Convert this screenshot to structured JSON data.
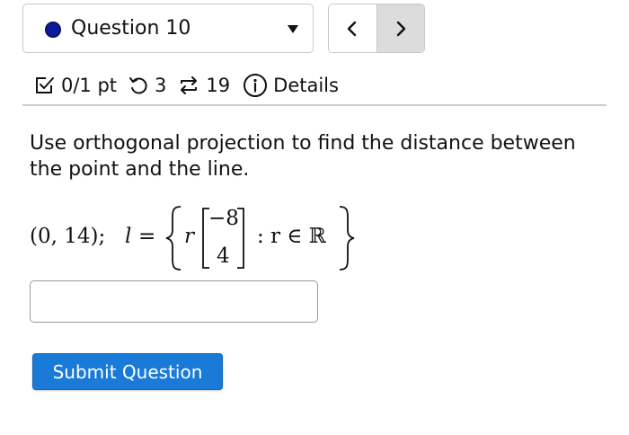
{
  "question_nav": {
    "selected_label": "Question 10",
    "status_color": "#0a1a9b",
    "prev_icon": "chevron-left-icon",
    "next_icon": "chevron-right-icon"
  },
  "info": {
    "score": "0/1 pt",
    "attempts": "3",
    "submissions": "19",
    "details_label": "Details"
  },
  "question": {
    "prompt": "Use orthogonal projection to find the distance between the point and the line.",
    "math": {
      "point": "(0, 14);",
      "line_var": "l",
      "equals": "=",
      "scalar": "r",
      "vector_top": "−8",
      "vector_bottom": "4",
      "condition": ": r ∈ ℝ"
    }
  },
  "answer": {
    "value": "",
    "placeholder": ""
  },
  "submit_label": "Submit Question"
}
